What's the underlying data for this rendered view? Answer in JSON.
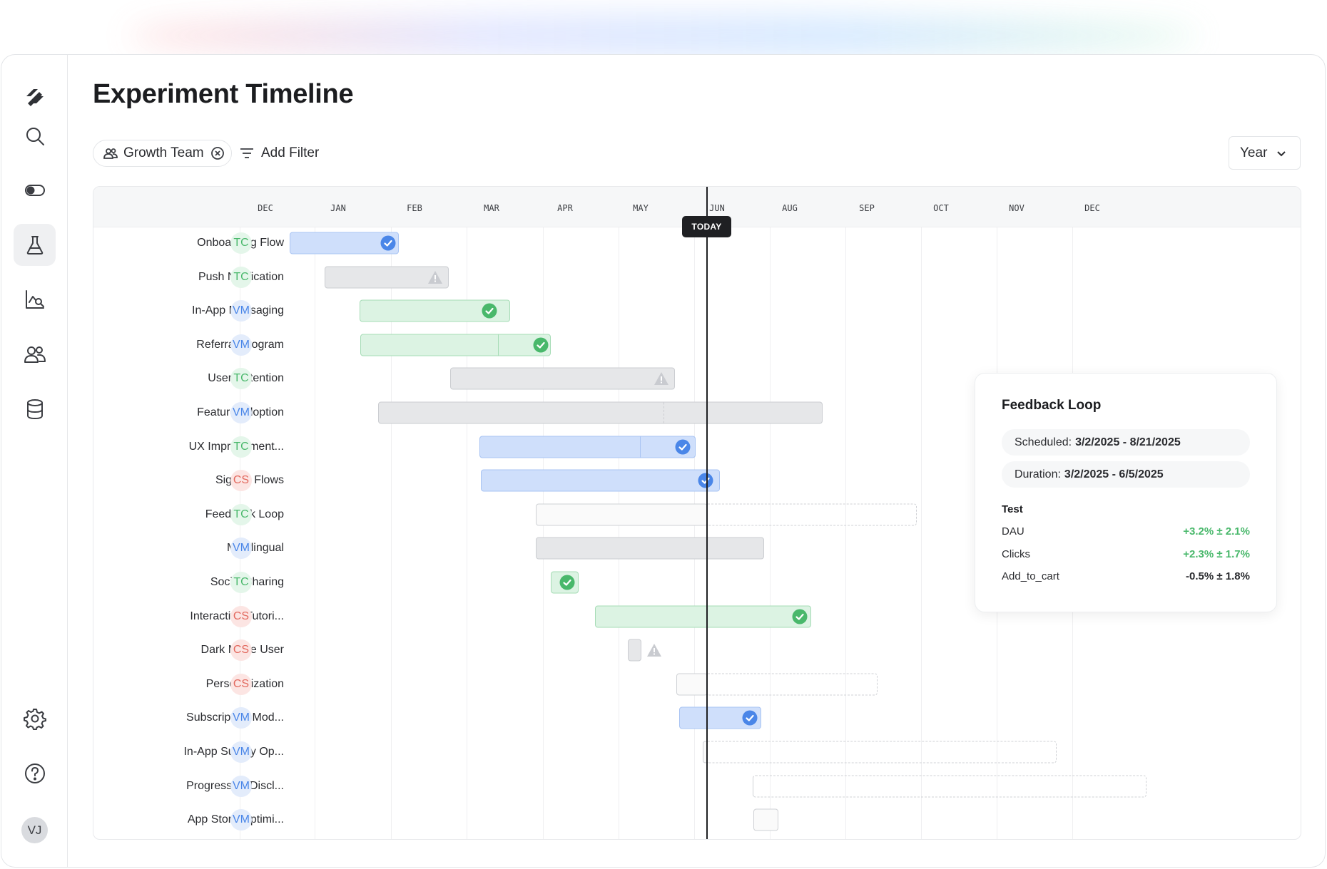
{
  "page": {
    "title": "Experiment Timeline"
  },
  "filters": {
    "team_chip": "Growth Team",
    "add_filter": "Add Filter",
    "period": "Year"
  },
  "user": {
    "initials": "VJ"
  },
  "sidebar": {
    "items": [
      {
        "name": "logo-icon",
        "icon": "logo-icon"
      },
      {
        "name": "search-icon",
        "icon": "search-icon"
      },
      {
        "name": "toggle-icon",
        "icon": "toggle-icon"
      },
      {
        "name": "flask-icon",
        "icon": "flask-icon",
        "active": true
      },
      {
        "name": "chart-search-icon",
        "icon": "chart-search-icon"
      },
      {
        "name": "users-icon",
        "icon": "users-icon"
      },
      {
        "name": "database-icon",
        "icon": "database-icon"
      },
      {
        "name": "gear-icon",
        "icon": "gear-icon"
      },
      {
        "name": "help-icon",
        "icon": "help-icon"
      }
    ]
  },
  "timeline": {
    "months": [
      "DEC",
      "JAN",
      "FEB",
      "MAR",
      "APR",
      "MAY",
      "JUN",
      "AUG",
      "SEP",
      "OCT",
      "NOV",
      "DEC"
    ],
    "today_label": "TODAY",
    "colors": {
      "blue": "#4a86e8",
      "green": "#49b86b",
      "gray": "#c9cbd0",
      "red": "#e2685d"
    },
    "rows": [
      {
        "label": "Onboarding Flow",
        "owner": "TC",
        "status": "blue-check",
        "icon": "check-circle-icon"
      },
      {
        "label": "Push Notification",
        "owner": "TC",
        "status": "warning",
        "icon": "warning-icon"
      },
      {
        "label": "In-App Messaging",
        "owner": "VM",
        "status": "green-check",
        "icon": "check-circle-icon"
      },
      {
        "label": "Referral Program",
        "owner": "VM",
        "status": "green-check",
        "icon": "check-circle-icon"
      },
      {
        "label": "User Retention",
        "owner": "TC",
        "status": "warning",
        "icon": "warning-icon"
      },
      {
        "label": "Feature Adoption",
        "owner": "VM",
        "status": "running"
      },
      {
        "label": "UX Improvement...",
        "owner": "TC",
        "status": "blue-check",
        "icon": "check-circle-icon"
      },
      {
        "label": "Signup Flows",
        "owner": "CS",
        "status": "blue-check",
        "icon": "check-circle-icon"
      },
      {
        "label": "Feedback Loop",
        "owner": "TC",
        "status": "scheduled"
      },
      {
        "label": "Multilingual",
        "owner": "VM",
        "status": "gray"
      },
      {
        "label": "Social Sharing",
        "owner": "TC",
        "status": "green-check",
        "icon": "check-circle-icon"
      },
      {
        "label": "Interactive Tutori...",
        "owner": "CS",
        "status": "green-check",
        "icon": "check-circle-icon"
      },
      {
        "label": "Dark Mode User",
        "owner": "CS",
        "status": "warning",
        "icon": "warning-icon"
      },
      {
        "label": "Personalization",
        "owner": "CS",
        "status": "scheduled"
      },
      {
        "label": "Subscription Mod...",
        "owner": "VM",
        "status": "blue-check",
        "icon": "check-circle-icon"
      },
      {
        "label": "In-App Survey Op...",
        "owner": "VM",
        "status": "scheduled"
      },
      {
        "label": "Progressive Discl...",
        "owner": "VM",
        "status": "scheduled"
      },
      {
        "label": "App Store Optimi...",
        "owner": "VM",
        "status": "scheduled"
      }
    ]
  },
  "tooltip": {
    "title": "Feedback Loop",
    "scheduled_label": "Scheduled:",
    "scheduled_value": "3/2/2025 - 8/21/2025",
    "duration_label": "Duration:",
    "duration_value": "3/2/2025 - 6/5/2025",
    "section": "Test",
    "metrics": [
      {
        "name": "DAU",
        "value": "+3.2% ± 2.1%",
        "trend": "positive"
      },
      {
        "name": "Clicks",
        "value": "+2.3% ± 1.7%",
        "trend": "positive"
      },
      {
        "name": "Add_to_cart",
        "value": "-0.5% ± 1.8%",
        "trend": "neutral"
      }
    ]
  }
}
